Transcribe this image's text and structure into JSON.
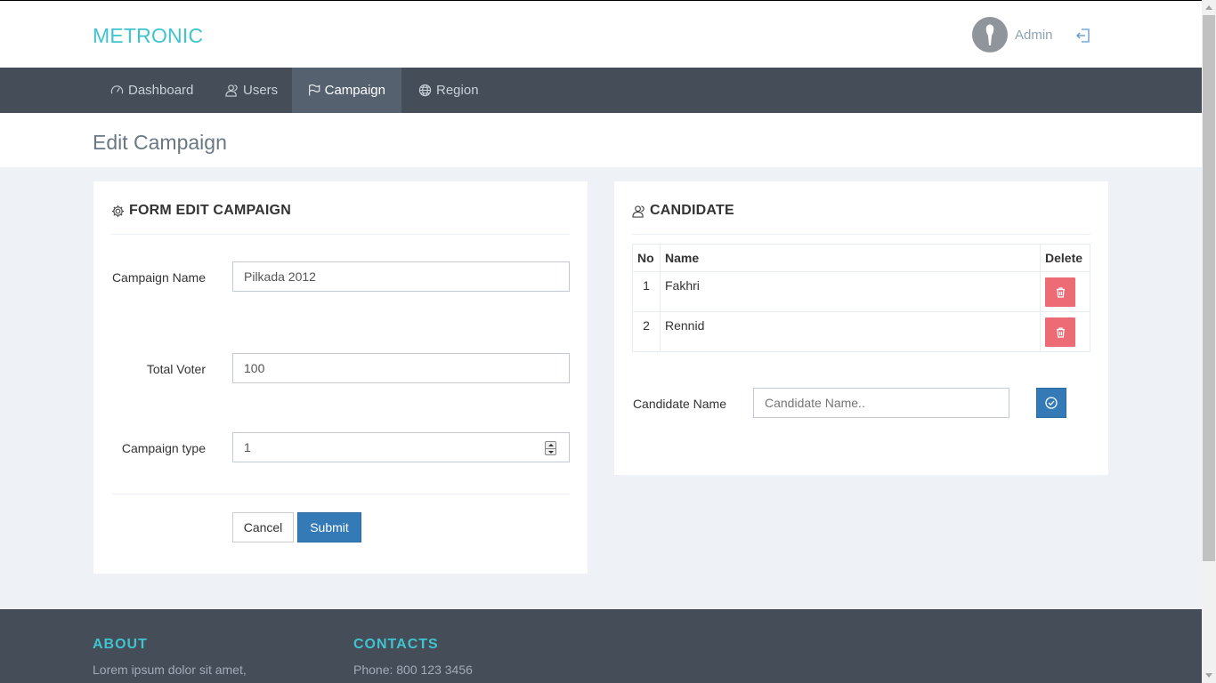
{
  "header": {
    "logo": "METRONIC",
    "user_name": "Admin"
  },
  "nav": [
    {
      "label": "Dashboard",
      "icon": "speedometer-icon"
    },
    {
      "label": "Users",
      "icon": "users-icon"
    },
    {
      "label": "Campaign",
      "icon": "flag-icon",
      "active": true
    },
    {
      "label": "Region",
      "icon": "globe-icon"
    }
  ],
  "page": {
    "title": "Edit Campaign"
  },
  "form": {
    "title": "FORM EDIT CAMPAIGN",
    "campaign_name_label": "Campaign Name",
    "campaign_name_value": "Pilkada 2012",
    "total_voter_label": "Total Voter",
    "total_voter_value": "100",
    "campaign_type_label": "Campaign type",
    "campaign_type_value": "1",
    "cancel_label": "Cancel",
    "submit_label": "Submit"
  },
  "candidate": {
    "title": "CANDIDATE",
    "columns": [
      "No",
      "Name",
      "Delete"
    ],
    "rows": [
      {
        "no": "1",
        "name": "Fakhri"
      },
      {
        "no": "2",
        "name": "Rennid"
      }
    ],
    "name_label": "Candidate Name",
    "name_placeholder": "Candidate Name.."
  },
  "footer": {
    "about_title": "ABOUT",
    "about_text": "Lorem ipsum dolor sit amet,",
    "contacts_title": "CONTACTS",
    "phone": "Phone: 800 123 3456"
  },
  "colors": {
    "accent": "#3fc4cf",
    "nav_bg": "#444d58",
    "primary": "#337ab7",
    "danger": "#ed6b75"
  }
}
